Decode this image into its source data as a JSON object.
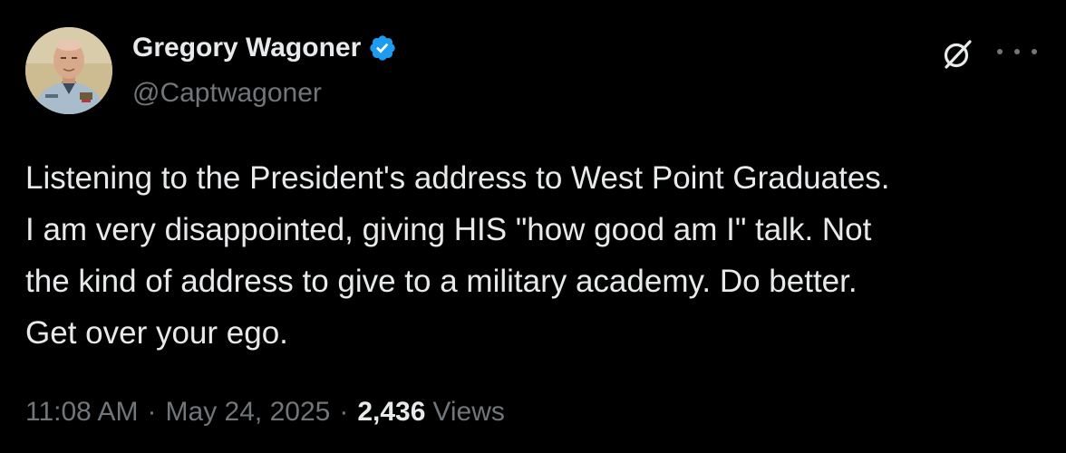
{
  "author": {
    "name": "Gregory Wagoner",
    "handle": "@Captwagoner",
    "verified": true
  },
  "tweet": {
    "lines": [
      "Listening to the President's address to West Point Graduates.",
      "I am very disappointed, giving HIS \"how good am I\" talk. Not",
      "the kind of address to give to a military academy. Do better.",
      "Get over your ego."
    ]
  },
  "meta": {
    "time": "11:08 AM",
    "separator": "·",
    "date": "May 24, 2025",
    "views_count": "2,436",
    "views_label": "Views"
  },
  "icons": {
    "verified": "verified-badge-icon",
    "grok": "grok-icon",
    "more": "more-options-icon"
  },
  "colors": {
    "background": "#000000",
    "primary_text": "#e7e9ea",
    "secondary_text": "#71767b",
    "verified_blue": "#1d9bf0"
  }
}
